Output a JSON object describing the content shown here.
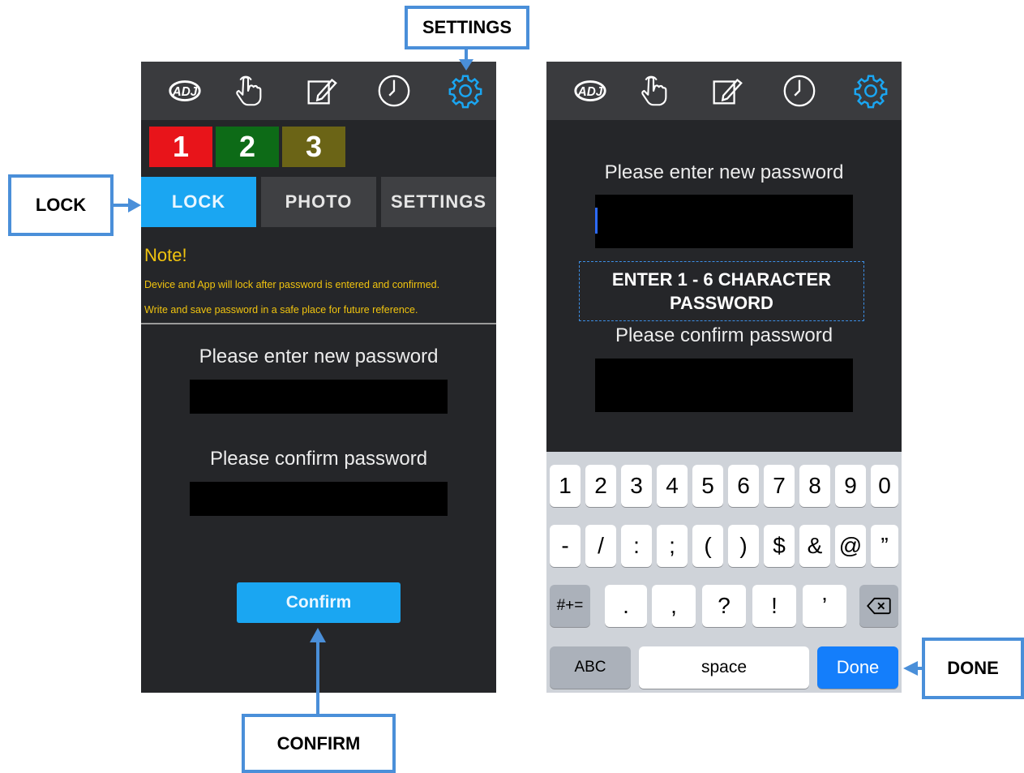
{
  "callouts": {
    "settings": "SETTINGS",
    "lock": "LOCK",
    "confirm": "CONFIRM",
    "done": "DONE"
  },
  "icons": [
    "adj-logo-icon",
    "touch-hand-icon",
    "edit-icon",
    "clock-icon",
    "gear-icon"
  ],
  "colors": {
    "accent": "#1aa6f2",
    "note_text": "#f1c40f",
    "preset_1": "#e8141a",
    "preset_2": "#0d6b17",
    "preset_3": "#6b6416",
    "done_key": "#147efb"
  },
  "left_screen": {
    "presets": [
      "1",
      "2",
      "3"
    ],
    "tabs": [
      "LOCK",
      "PHOTO",
      "SETTINGS"
    ],
    "active_tab": "LOCK",
    "note_title": "Note!",
    "note_line1": "Device and App will lock after password is entered and confirmed.",
    "note_line2": "Write and save password in a safe place for future reference.",
    "new_password_label": "Please enter new password",
    "confirm_password_label": "Please confirm password",
    "confirm_button": "Confirm"
  },
  "right_screen": {
    "new_password_label": "Please enter new password",
    "hint_line1": "ENTER 1 - 6 CHARACTER",
    "hint_line2": "PASSWORD",
    "confirm_password_label": "Please confirm password",
    "keyboard": {
      "row1": [
        "1",
        "2",
        "3",
        "4",
        "5",
        "6",
        "7",
        "8",
        "9",
        "0"
      ],
      "row2": [
        "-",
        "/",
        ":",
        ";",
        "(",
        ")",
        "$",
        "&",
        "@",
        "”"
      ],
      "row3_toggle": "#+=",
      "row3": [
        ".",
        ",",
        "?",
        "!",
        "’"
      ],
      "abc": "ABC",
      "space": "space",
      "done": "Done"
    }
  }
}
